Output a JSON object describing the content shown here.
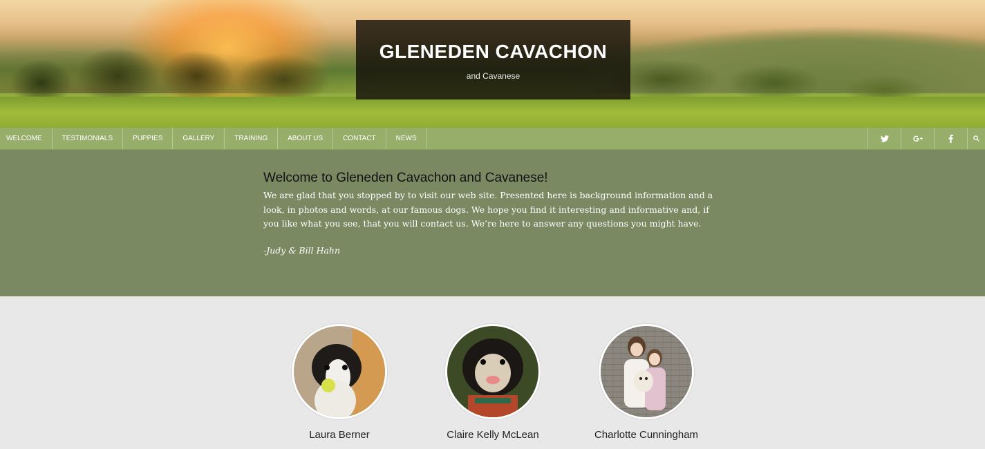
{
  "site": {
    "title": "GLENEDEN CAVACHON",
    "subtitle": "and Cavanese"
  },
  "nav": {
    "items": [
      {
        "label": "WELCOME"
      },
      {
        "label": "TESTIMONIALS"
      },
      {
        "label": "PUPPIES"
      },
      {
        "label": "GALLERY"
      },
      {
        "label": "TRAINING"
      },
      {
        "label": "ABOUT US"
      },
      {
        "label": "CONTACT"
      },
      {
        "label": "NEWS"
      }
    ],
    "social": [
      "twitter-icon",
      "google-plus-icon",
      "facebook-icon",
      "search-icon"
    ]
  },
  "welcome": {
    "heading": "Welcome to Gleneden Cavachon and Cavanese!",
    "body": "We are  glad that you stopped by to visit our web site. Presented here is background information and a look, in photos and words, at our famous dogs. We hope you find it interesting and informative and, if you like what you see, that you will contact us. We’re here to answer any questions you might have.",
    "signature": "-Judy & Bill Hahn"
  },
  "testimonials": [
    {
      "name": "Laura Berner"
    },
    {
      "name": "Claire Kelly McLean"
    },
    {
      "name": "Charlotte Cunningham"
    }
  ],
  "colors": {
    "nav_bg": "#97ae6b",
    "welcome_bg": "#7b8963",
    "page_bg": "#e8e8e8"
  }
}
